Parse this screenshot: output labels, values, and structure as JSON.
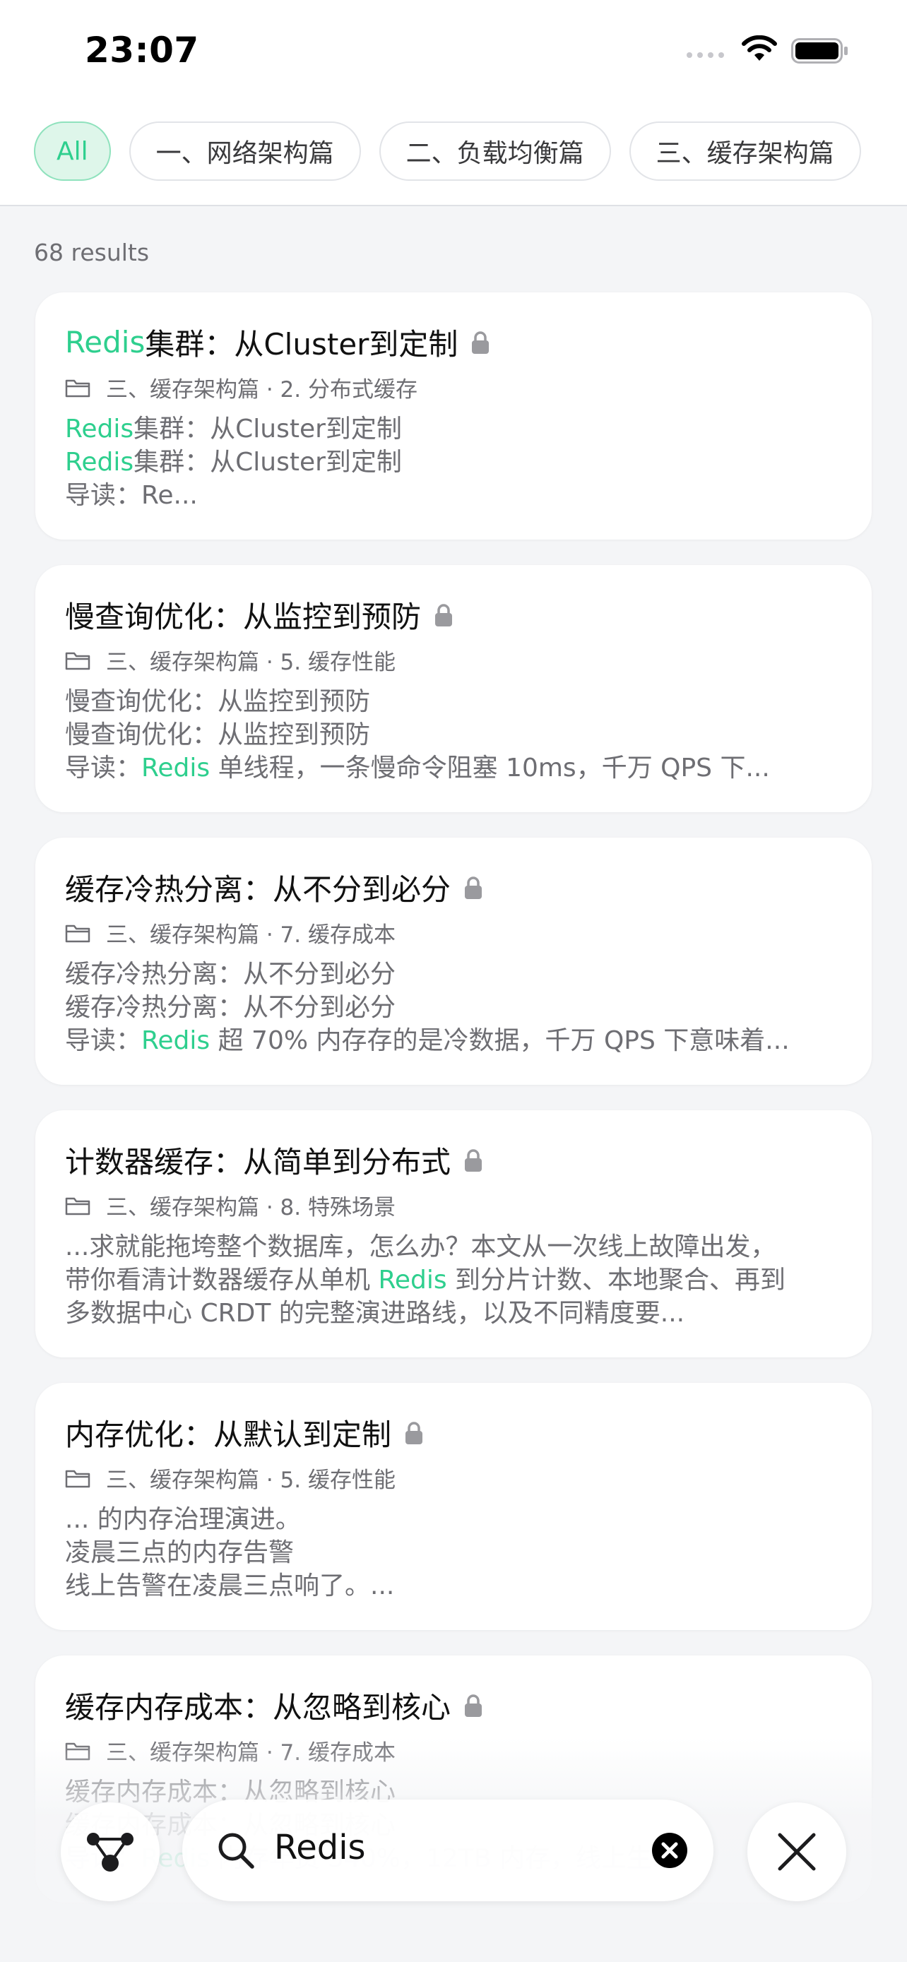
{
  "status": {
    "time": "23:07"
  },
  "filters": [
    "All",
    "一、网络架构篇",
    "二、负载均衡篇",
    "三、缓存架构篇"
  ],
  "results_count": "68 results",
  "results": [
    {
      "title": [
        {
          "t": "Redis",
          "hl": true
        },
        {
          "t": "集群：从Cluster到定制",
          "hl": false
        }
      ],
      "meta": "三、缓存架构篇 · 2. 分布式缓存",
      "lines": [
        [
          {
            "t": "Redis",
            "hl": true
          },
          {
            "t": "集群：从Cluster到定制",
            "hl": false
          }
        ],
        [
          {
            "t": "Redis",
            "hl": true
          },
          {
            "t": "集群：从Cluster到定制",
            "hl": false
          }
        ],
        [
          {
            "t": "导读：Re...",
            "hl": false
          }
        ]
      ]
    },
    {
      "title": [
        {
          "t": "慢查询优化：从监控到预防",
          "hl": false
        }
      ],
      "meta": "三、缓存架构篇 · 5. 缓存性能",
      "lines": [
        [
          {
            "t": "慢查询优化：从监控到预防",
            "hl": false
          }
        ],
        [
          {
            "t": "慢查询优化：从监控到预防",
            "hl": false
          }
        ],
        [
          {
            "t": "导读：",
            "hl": false
          },
          {
            "t": "Redis",
            "hl": true
          },
          {
            "t": " 单线程，一条慢命令阻塞 10ms，千万 QPS 下...",
            "hl": false
          }
        ]
      ]
    },
    {
      "title": [
        {
          "t": "缓存冷热分离：从不分到必分",
          "hl": false
        }
      ],
      "meta": "三、缓存架构篇 · 7. 缓存成本",
      "lines": [
        [
          {
            "t": "缓存冷热分离：从不分到必分",
            "hl": false
          }
        ],
        [
          {
            "t": "缓存冷热分离：从不分到必分",
            "hl": false
          }
        ],
        [
          {
            "t": "导读：",
            "hl": false
          },
          {
            "t": "Redis",
            "hl": true
          },
          {
            "t": " 超 70% 内存存的是冷数据，千万 QPS 下意味着...",
            "hl": false
          }
        ]
      ]
    },
    {
      "title": [
        {
          "t": "计数器缓存：从简单到分布式",
          "hl": false
        }
      ],
      "meta": "三、缓存架构篇 · 8. 特殊场景",
      "lines": [
        [
          {
            "t": "...求就能拖垮整个数据库，怎么办？本文从一次线上故障出发，",
            "hl": false
          }
        ],
        [
          {
            "t": "带你看清计数器缓存从单机 ",
            "hl": false
          },
          {
            "t": "Redis",
            "hl": true
          },
          {
            "t": " 到分片计数、本地聚合、再到",
            "hl": false
          }
        ],
        [
          {
            "t": "多数据中心 CRDT 的完整演进路线，以及不同精度要...",
            "hl": false
          }
        ]
      ]
    },
    {
      "title": [
        {
          "t": "内存优化：从默认到定制",
          "hl": false
        }
      ],
      "meta": "三、缓存架构篇 · 5. 缓存性能",
      "lines": [
        [
          {
            "t": "... 的内存治理演进。",
            "hl": false
          }
        ],
        [
          {
            "t": "凌晨三点的内存告警",
            "hl": false
          }
        ],
        [
          {
            "t": "线上告警在凌晨三点响了。...",
            "hl": false
          }
        ]
      ]
    },
    {
      "title": [
        {
          "t": "缓存内存成本：从忽略到核心",
          "hl": false
        }
      ],
      "meta": "三、缓存架构篇 · 7. 缓存成本",
      "lines": [
        [
          {
            "t": "缓存内存成本：从忽略到核心",
            "hl": false
          }
        ],
        [
          {
            "t": "缓存内存成本：从忽略到核心",
            "hl": false
          }
        ],
        [
          {
            "t": "导读：",
            "hl": false
          },
          {
            "t": "Redis",
            "hl": true
          },
          {
            "t": " 内存年费 340%，12TB 内存，线上生...",
            "hl": false
          }
        ]
      ]
    }
  ],
  "search": {
    "query": "Redis"
  },
  "colors": {
    "accent": "#2ecf8e",
    "chip_active_bg": "#def6ea",
    "background": "#f4f5f7"
  },
  "icons": [
    "wifi-icon",
    "battery-icon",
    "lock-icon",
    "folder-icon",
    "graph-icon",
    "search-icon",
    "clear-icon",
    "close-icon"
  ]
}
